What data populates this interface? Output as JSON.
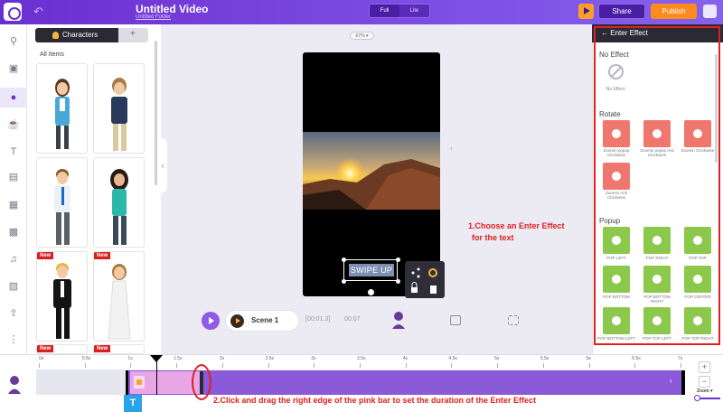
{
  "app": {
    "title": "Untitled Video",
    "subtitle": "Untitled Folder"
  },
  "view_toggle": {
    "options": [
      "Full",
      "Lite"
    ],
    "selected": "Full"
  },
  "actions": {
    "share": "Share",
    "publish": "Publish"
  },
  "rail": {
    "icons": [
      "search-icon",
      "scenes-icon",
      "characters-icon",
      "props-icon",
      "text-icon",
      "background-icon",
      "images-icon",
      "video-icon",
      "music-icon",
      "chart-icon",
      "upload-icon",
      "more-icon"
    ],
    "active": "characters-icon"
  },
  "characters_panel": {
    "tab_label": "Characters",
    "section_label": "All Items",
    "new_badge": "New",
    "items": [
      {
        "name": "woman-blue-blazer",
        "is_new": false
      },
      {
        "name": "man-navy-sweater",
        "is_new": false
      },
      {
        "name": "man-blue-tie",
        "is_new": false
      },
      {
        "name": "woman-teal-top",
        "is_new": false
      },
      {
        "name": "man-black-tuxedo",
        "is_new": true
      },
      {
        "name": "woman-white-dress",
        "is_new": true
      },
      {
        "name": "character-7",
        "is_new": true
      },
      {
        "name": "character-8",
        "is_new": true
      }
    ]
  },
  "canvas": {
    "zoom": "67%",
    "selected_text": "SWIPE UP",
    "scene_label": "Scene 1",
    "time_current": "[00:01.3]",
    "time_total": "00:07"
  },
  "annotations": {
    "step1_line1": "1.Choose an Enter Effect",
    "step1_line2": "for the text",
    "step2": "2.Click and drag the right edge of the pink bar to set the duration of the Enter Effect"
  },
  "effect_panel": {
    "header": "Enter Effect",
    "no_effect_title": "No Effect",
    "no_effect_label": "No Effect",
    "rotate_title": "Rotate",
    "rotate_items": [
      "Zoomin popup Clockwise",
      "Zoomin popup Anti Clockwise",
      "Zoomin Clockwise",
      "Zoomin Anti Clockwise"
    ],
    "popup_title": "Popup",
    "popup_items": [
      "POP LEFT",
      "POP RIGHT",
      "POP TOP",
      "POP BOTTOM",
      "POP BOTTOM RIGHT",
      "POP CENTER",
      "POP BOTTOM LEFT",
      "POP TOP LEFT",
      "POP TOP RIGHT"
    ]
  },
  "timeline": {
    "ticks": [
      "0s",
      "0.5s",
      "1s",
      "1.5s",
      "2s",
      "2.5s",
      "3s",
      "3.5s",
      "4s",
      "4.5s",
      "5s",
      "5.5s",
      "6s",
      "6.5s",
      "7s"
    ],
    "text_layer_badge": "T",
    "zoom_label": "Zoom",
    "zoom_in": "+",
    "zoom_out": "−"
  },
  "colors": {
    "brand": "#6a2fd0",
    "publish": "#ff8a1e",
    "rotate_effect": "#f0776e",
    "popup_effect": "#8cc84b",
    "annotation": "#e02020",
    "enter_effect_bar": "#e8a6e6",
    "text_track": "#8a5ad8"
  }
}
